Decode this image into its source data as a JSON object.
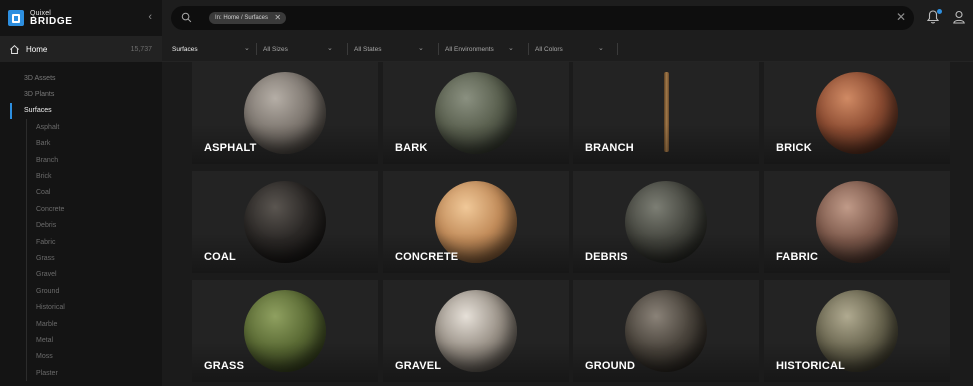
{
  "brand": {
    "line1": "Quixel",
    "line2": "BRIDGE"
  },
  "sidebar": {
    "home_label": "Home",
    "home_count": "15,737",
    "items": [
      {
        "label": "3D Assets",
        "active": false
      },
      {
        "label": "3D Plants",
        "active": false
      },
      {
        "label": "Surfaces",
        "active": true
      }
    ],
    "children": [
      "Asphalt",
      "Bark",
      "Branch",
      "Brick",
      "Coal",
      "Concrete",
      "Debris",
      "Fabric",
      "Grass",
      "Gravel",
      "Ground",
      "Historical",
      "Marble",
      "Metal",
      "Moss",
      "Plaster"
    ]
  },
  "search": {
    "chip": "In: Home / Surfaces",
    "chip_close": "✕",
    "clear": "✕"
  },
  "filters": [
    {
      "label": "Surfaces",
      "primary": true
    },
    {
      "label": "All Sizes",
      "primary": false
    },
    {
      "label": "All States",
      "primary": false
    },
    {
      "label": "All Environments",
      "primary": false
    },
    {
      "label": "All Colors",
      "primary": false
    }
  ],
  "cards": [
    {
      "label": "ASPHALT",
      "icon": "asphalt-sphere",
      "colors": [
        "#b5aea6",
        "#7d766f",
        "#2f2b27"
      ]
    },
    {
      "label": "BARK",
      "icon": "bark-sphere",
      "colors": [
        "#8a9080",
        "#5a604f",
        "#222620"
      ]
    },
    {
      "label": "BRANCH",
      "icon": "branch-stick",
      "colors": []
    },
    {
      "label": "BRICK",
      "icon": "brick-sphere",
      "colors": [
        "#d08a64",
        "#8c4c32",
        "#3a1e14"
      ]
    },
    {
      "label": "COAL",
      "icon": "coal-sphere",
      "colors": [
        "#5a5550",
        "#2b2826",
        "#0d0c0b"
      ]
    },
    {
      "label": "CONCRETE",
      "icon": "concrete-sphere",
      "colors": [
        "#f0c898",
        "#c28c5a",
        "#5a3a1e"
      ]
    },
    {
      "label": "DEBRIS",
      "icon": "debris-sphere",
      "colors": [
        "#7c7e74",
        "#45463f",
        "#161714"
      ]
    },
    {
      "label": "FABRIC",
      "icon": "fabric-sphere",
      "colors": [
        "#c09a88",
        "#7e5a4c",
        "#33221c"
      ]
    },
    {
      "label": "GRASS",
      "icon": "grass-sphere",
      "colors": [
        "#8fa060",
        "#5a6a34",
        "#222a12"
      ]
    },
    {
      "label": "GRAVEL",
      "icon": "gravel-sphere",
      "colors": [
        "#e6e0d8",
        "#9a9288",
        "#3a3530"
      ]
    },
    {
      "label": "GROUND",
      "icon": "ground-sphere",
      "colors": [
        "#8a8278",
        "#4a443c",
        "#161310"
      ]
    },
    {
      "label": "HISTORICAL",
      "icon": "historical-sphere",
      "colors": [
        "#b0aa90",
        "#6a6650",
        "#26241a"
      ]
    }
  ]
}
